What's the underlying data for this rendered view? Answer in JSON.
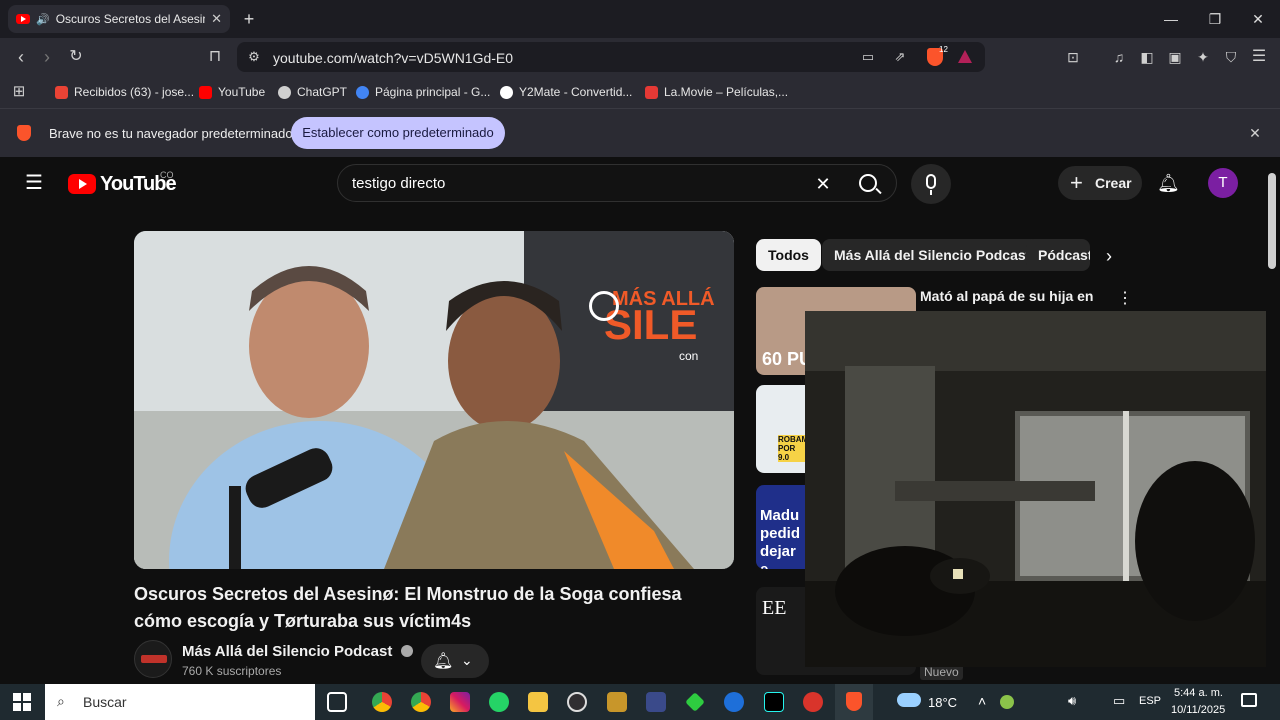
{
  "browser": {
    "tab_title": "Oscuros Secretos del Asesinø",
    "new_tab": "+",
    "url": "youtube.com/watch?v=vD5WN1Gd-E0",
    "shield_count": "12",
    "bookmarks": [
      {
        "label": "Recibidos (63) - jose...",
        "color": "#ea4335"
      },
      {
        "label": "YouTube",
        "color": "#ff0000"
      },
      {
        "label": "ChatGPT",
        "color": "#cfcfcf"
      },
      {
        "label": "Página principal - G...",
        "color": "#4285f4"
      },
      {
        "label": "Y2Mate - Convertid...",
        "color": "#ffffff"
      },
      {
        "label": "La.Movie – Películas,...",
        "color": "#e53935"
      }
    ],
    "infobar_text": "Brave no es tu navegador predeterminado",
    "infobar_button": "Establecer como predeterminado"
  },
  "youtube": {
    "logo_text": "YouTube",
    "country": "CO",
    "search_value": "testigo directo",
    "create_label": "Crear",
    "avatar_letter": "T",
    "video_title": "Oscuros Secretos del Asesinø: El Monstruo de la Soga confiesa cómo escogía y Tørturaba sus víctim4s",
    "channel_name": "Más Allá del Silencio Podcast",
    "subscribers": "760 K suscriptores",
    "video_banner_line1": "MÁS ALLÁ",
    "video_banner_line2": "SILE",
    "video_banner_line3": "con",
    "chips": [
      "Todos",
      "Más Allá del Silencio Podcast",
      "Pódcast"
    ],
    "recommended": [
      {
        "title_line1": "Mató al papá de su hija en",
        "thumb_text": "60 PU"
      },
      {
        "thumb_text": "ROBAMO POR 9.0"
      },
      {
        "thumb_text": "Madu pedid dejar e"
      },
      {
        "thumb_text": "EE"
      }
    ],
    "badge_new": "Nuevo"
  },
  "taskbar": {
    "search_placeholder": "Buscar",
    "weather": "18°C",
    "language": "ESP",
    "time": "5:44 a. m.",
    "date": "10/11/2025"
  },
  "colors": {
    "youtube_red": "#ff0000",
    "brave_orange": "#fb542b",
    "infobar_button_bg": "#c5c4ff"
  }
}
